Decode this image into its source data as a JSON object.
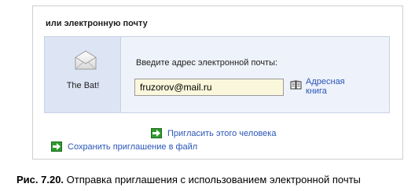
{
  "section_title": "или электронную почту",
  "client": {
    "name": "The Bat!",
    "icon": "envelope-icon"
  },
  "email": {
    "prompt": "Введите адрес электронной почты:",
    "value": "fruzorov@mail.ru",
    "address_book_label": "Адресная книга",
    "address_book_icon": "book-icon"
  },
  "actions": {
    "invite_label": "Пригласить этого человека",
    "save_label": "Сохранить приглашение в файл"
  },
  "caption": {
    "number": "Рис. 7.20.",
    "text": "Отправка приглашения с использованием электронной почты"
  },
  "colors": {
    "link": "#2a56b8",
    "panel": "#eef2fa",
    "client_pane": "#dde4f3",
    "input_bg": "#fbf7dc",
    "go_icon": "#2f9a2f"
  }
}
